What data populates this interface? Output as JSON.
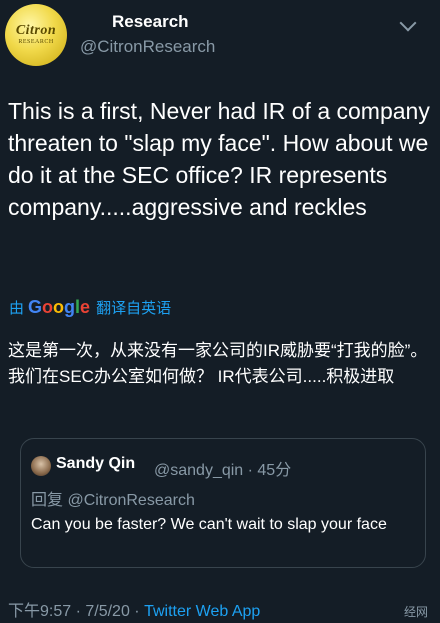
{
  "header": {
    "avatar_line1": "Citron",
    "avatar_line2": "RESEARCH",
    "display_name": "Research",
    "handle": "@CitronResearch"
  },
  "tweet": {
    "text": "This is a first, Never had IR of a company threaten to \"slap my face\". How about we do it at the SEC office? IR represents company.....aggressive and reckles"
  },
  "translation": {
    "by_label": "由",
    "google_letters": [
      "G",
      "o",
      "o",
      "g",
      "l",
      "e"
    ],
    "action_label": "翻译自英语",
    "translated_text": "这是第一次，从来没有一家公司的IR威胁要“打我的脸”。我们在SEC办公室如何做？ IR代表公司.....积极进取"
  },
  "quoted_tweet": {
    "name": "Sandy Qin",
    "meta": "@sandy_qin · 45分",
    "reply_to": "回复 @CitronResearch",
    "text": "Can you be faster? We can't wait to slap your face"
  },
  "footer": {
    "time": "下午9:57 · 7/5/20 · ",
    "source": "Twitter Web App"
  },
  "watermark": "经网",
  "icons": {
    "menu": "chevron-down-icon"
  }
}
